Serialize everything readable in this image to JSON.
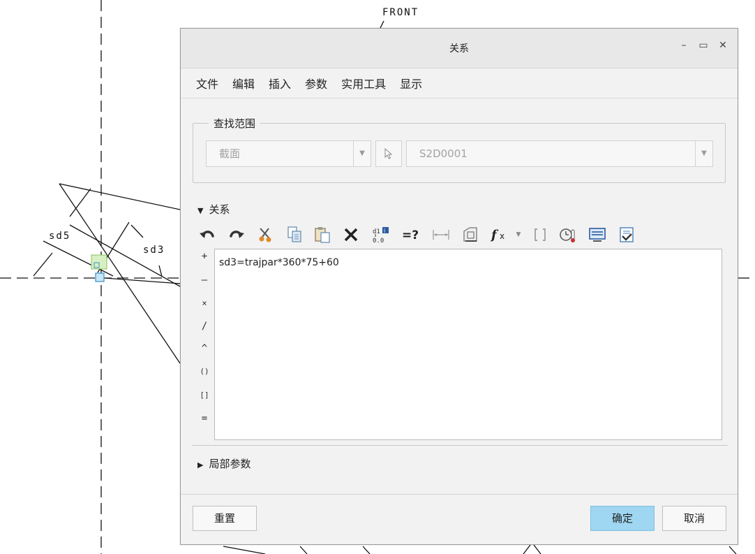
{
  "background": {
    "labels": {
      "front": "FRONT",
      "sd5": "sd5",
      "sd3": "sd3"
    }
  },
  "dialog": {
    "title": "关系",
    "window_controls": {
      "minimize": "–",
      "maximize": "▭",
      "close": "✕"
    },
    "menu": [
      "文件",
      "编辑",
      "插入",
      "参数",
      "实用工具",
      "显示"
    ],
    "lookup": {
      "legend": "查找范围",
      "scope_value": "截面",
      "object_value": "S2D0001"
    },
    "relations_section": {
      "label": "关系",
      "expanded": true
    },
    "toolbar_icons": [
      "undo-icon",
      "redo-icon",
      "cut-icon",
      "copy-icon",
      "paste-icon",
      "delete-icon",
      "sort-relations-icon",
      "evaluate-icon",
      "show-dimension-icon",
      "insert-from-list-icon",
      "function-icon",
      "brackets-icon",
      "unit-sensitivity-icon",
      "display-icon",
      "verify-icon"
    ],
    "operators": [
      "+",
      "–",
      "×",
      "/",
      "^",
      "()",
      "[]",
      "="
    ],
    "editor_text": "sd3=trajpar*360*75+60",
    "local_params_section": {
      "label": "局部参数",
      "expanded": false
    },
    "buttons": {
      "reset": "重置",
      "ok": "确定",
      "cancel": "取消"
    },
    "colors": {
      "accent": "#9fd6f2",
      "cut": "#e08a2a",
      "function": "#222222",
      "verify": "#4a7fb8"
    }
  }
}
